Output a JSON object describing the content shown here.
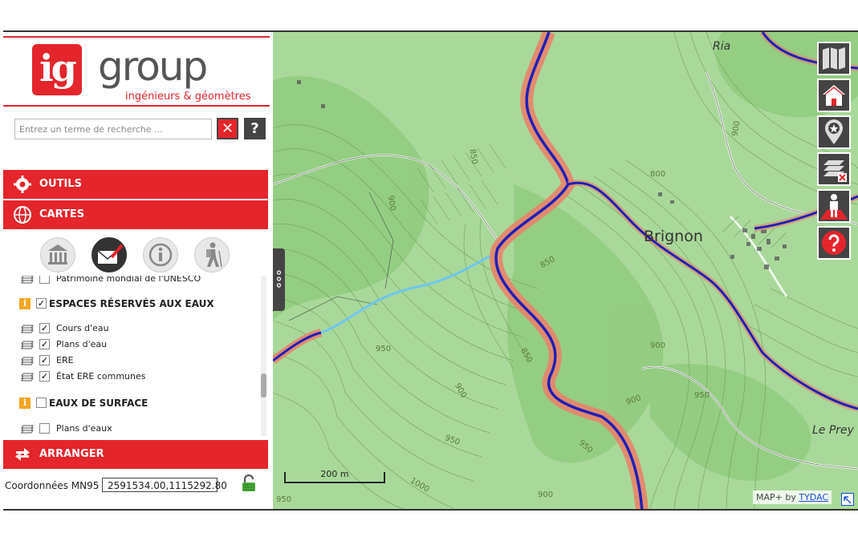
{
  "brand": {
    "mark": "ig",
    "name": "group",
    "tagline": "ingénieurs & géomètres"
  },
  "search": {
    "placeholder": "Entrez un terme de recherche ...",
    "clear_label": "✕",
    "help_label": "?"
  },
  "sections": {
    "outils": "OUTILS",
    "cartes": "CARTES",
    "arranger": "ARRANGER"
  },
  "category_icons": [
    "building-icon",
    "envelope-pen-icon",
    "info-icon",
    "hiker-icon"
  ],
  "layers": {
    "top_partial": {
      "label": "Patrimoine mondial de l'UNESCO",
      "checked": false
    },
    "group1": {
      "label": "ESPACES RÉSERVÉS AUX EAUX",
      "checked": true,
      "items": [
        {
          "label": "Cours d'eau",
          "checked": true
        },
        {
          "label": "Plans d'eau",
          "checked": true
        },
        {
          "label": "ERE",
          "checked": true
        },
        {
          "label": "État ERE communes",
          "checked": true
        }
      ]
    },
    "group2": {
      "label": "EAUX DE SURFACE",
      "checked": false,
      "items": [
        {
          "label": "Plans d'eaux",
          "checked": false
        }
      ]
    }
  },
  "coordinates": {
    "label": "Coordonnées MN95",
    "value": "2591534.00,1115292.80"
  },
  "map": {
    "places": {
      "brignon": "Brignon",
      "ria": "Ria",
      "le_prey": "Le Prey"
    },
    "contour_labels": {
      "c1": "900",
      "c2": "850",
      "c3": "900",
      "c4": "850",
      "c5": "900",
      "c6": "950",
      "c7": "850",
      "c8": "900",
      "c9": "950",
      "c10": "900",
      "c11": "950",
      "c12": "950",
      "c13": "1000",
      "c14": "950",
      "c15": "900",
      "c16": "800"
    },
    "scale_label": "200 m",
    "attribution_prefix": "MAP+ by",
    "attribution_link": "TYDAC",
    "colors": {
      "terrain": "#a9d99a",
      "river": "#1f1fb8",
      "river_buffer": "#e8836a",
      "stream": "#6ec6f0",
      "accent": "#e4252b"
    }
  },
  "map_controls": [
    "map-toggle-icon",
    "home-icon",
    "marker-star-icon",
    "layers-remove-icon",
    "person-icon",
    "help-icon"
  ]
}
